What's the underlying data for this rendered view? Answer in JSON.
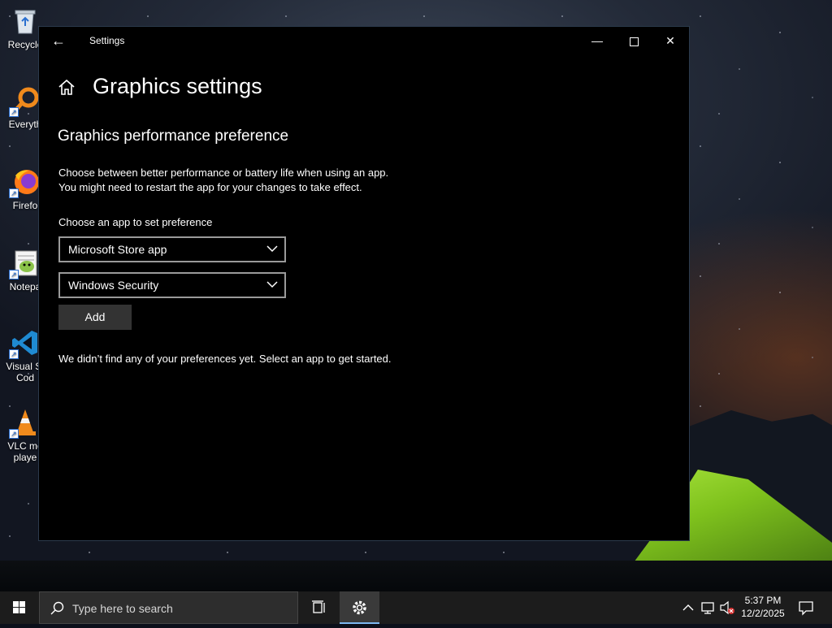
{
  "desktop": {
    "icons": [
      {
        "label": "Recycle"
      },
      {
        "label": "Everyth"
      },
      {
        "label": "Firefo"
      },
      {
        "label": "Notepa"
      },
      {
        "label": "Visual St",
        "label2": "Cod"
      },
      {
        "label": "VLC me",
        "label2": "playe"
      }
    ]
  },
  "window": {
    "title": "Settings",
    "page_title": "Graphics settings",
    "section_title": "Graphics performance preference",
    "description_line1": "Choose between better performance or battery life when using an app.",
    "description_line2": "You might need to restart the app for your changes to take effect.",
    "choose_label": "Choose an app to set preference",
    "app_type_dropdown": {
      "value": "Microsoft Store app"
    },
    "app_dropdown": {
      "value": "Windows Security"
    },
    "add_button": "Add",
    "empty_message": "We didn’t find any of your preferences yet. Select an app to get started."
  },
  "taskbar": {
    "search_placeholder": "Type here to search",
    "time": "5:37 PM",
    "date": "12/2/2025"
  },
  "colors": {
    "window_bg": "#000000",
    "accent_underline": "#7db7f0",
    "add_button_bg": "#333333",
    "tent_green": "#8fd42a"
  }
}
